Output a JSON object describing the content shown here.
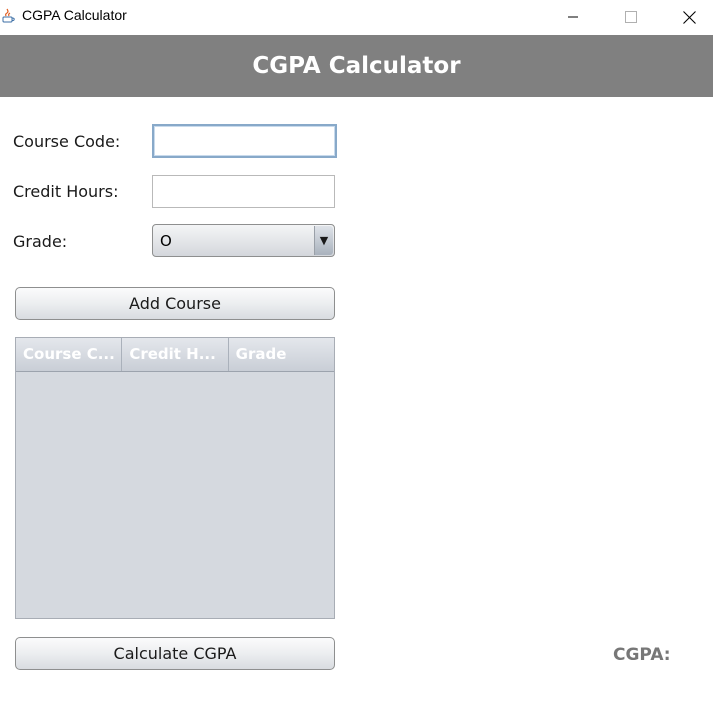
{
  "window": {
    "title": "CGPA Calculator",
    "controls": {
      "minimize": "minimize-icon",
      "maximize": "maximize-icon",
      "close": "close-icon"
    }
  },
  "header": {
    "title": "CGPA Calculator",
    "background": "#808080"
  },
  "form": {
    "course_code_label": "Course Code:",
    "course_code_value": "",
    "credit_hours_label": "Credit Hours:",
    "credit_hours_value": "",
    "grade_label": "Grade:",
    "grade_selected": "O"
  },
  "buttons": {
    "add_course": "Add Course",
    "calculate": "Calculate CGPA"
  },
  "table": {
    "columns": [
      "Course C...",
      "Credit H...",
      "Grade"
    ],
    "rows": []
  },
  "result": {
    "cgpa_label": "CGPA:"
  }
}
